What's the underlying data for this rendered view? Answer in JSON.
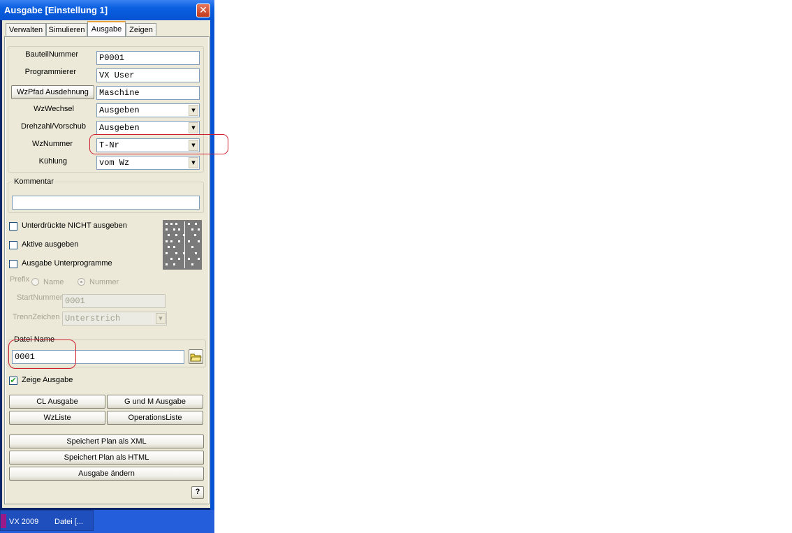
{
  "window": {
    "title": "Ausgabe [Einstellung 1]",
    "close_glyph": "✕"
  },
  "tabs": [
    {
      "label": "Verwalten"
    },
    {
      "label": "Simulieren"
    },
    {
      "label": "Ausgabe",
      "active": true
    },
    {
      "label": "Zeigen"
    }
  ],
  "fields": {
    "bauteilnummer": {
      "label": "BauteilNummer",
      "value": "P0001"
    },
    "programmierer": {
      "label": "Programmierer",
      "value": "VX User"
    },
    "wzpfad": {
      "button": "WzPfad Ausdehnung",
      "value": "Maschine"
    },
    "wzwechsel": {
      "label": "WzWechsel",
      "value": "Ausgeben"
    },
    "drehzahl": {
      "label": "Drehzahl/Vorschub",
      "value": "Ausgeben"
    },
    "wznummer": {
      "label": "WzNummer",
      "value": "T-Nr"
    },
    "kuehlung": {
      "label": "Kühlung",
      "value": "vom Wz"
    }
  },
  "kommentar": {
    "title": "Kommentar",
    "value": ""
  },
  "checks": {
    "unterdrueckte": {
      "label": "Unterdrückte NICHT ausgeben",
      "checked": false
    },
    "aktive": {
      "label": "Aktive ausgeben",
      "checked": false
    },
    "unterprogramme": {
      "label": "Ausgabe Unterprogramme",
      "checked": false
    },
    "zeige": {
      "label": "Zeige Ausgabe",
      "checked": true,
      "mark": "✔"
    }
  },
  "prefix": {
    "label": "Prefix",
    "option_name": "Name",
    "option_nummer": "Nummer",
    "selected": "Nummer"
  },
  "startnummer": {
    "label": "StartNummer",
    "value": "0001"
  },
  "trennzeichen": {
    "label": "TrennZeichen",
    "value": "Unterstrich"
  },
  "datei": {
    "title": "Datei Name",
    "value": "0001"
  },
  "buttons": {
    "cl": "CL Ausgabe",
    "gm": "G und M Ausgabe",
    "wzliste": "WzListe",
    "opliste": "OperationsListe",
    "xml": "Speichert Plan als XML",
    "html": "Speichert Plan als HTML",
    "aendern": "Ausgabe ändern",
    "help": "?"
  },
  "taskbar": {
    "app": "VX 2009",
    "item": "Datei [..."
  },
  "colors": {
    "highlight": "#d02030",
    "titlebar": "#0553d2"
  }
}
